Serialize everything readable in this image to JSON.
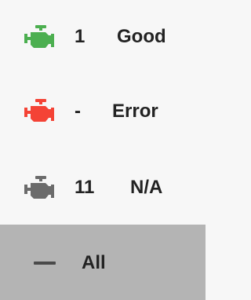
{
  "status_filter": {
    "items": [
      {
        "id": "good",
        "count": "1",
        "label": "Good",
        "icon": "engine-icon",
        "color": "#4caf50"
      },
      {
        "id": "error",
        "count": "-",
        "label": "Error",
        "icon": "engine-icon",
        "color": "#f44336"
      },
      {
        "id": "na",
        "count": "11",
        "label": "N/A",
        "icon": "engine-icon",
        "color": "#6b6b6b"
      }
    ],
    "all": {
      "label": "All",
      "icon": "dash-icon",
      "selected": true
    }
  },
  "colors": {
    "background": "#f7f7f7",
    "selected_row": "#b4b4b4",
    "text": "#222222"
  }
}
